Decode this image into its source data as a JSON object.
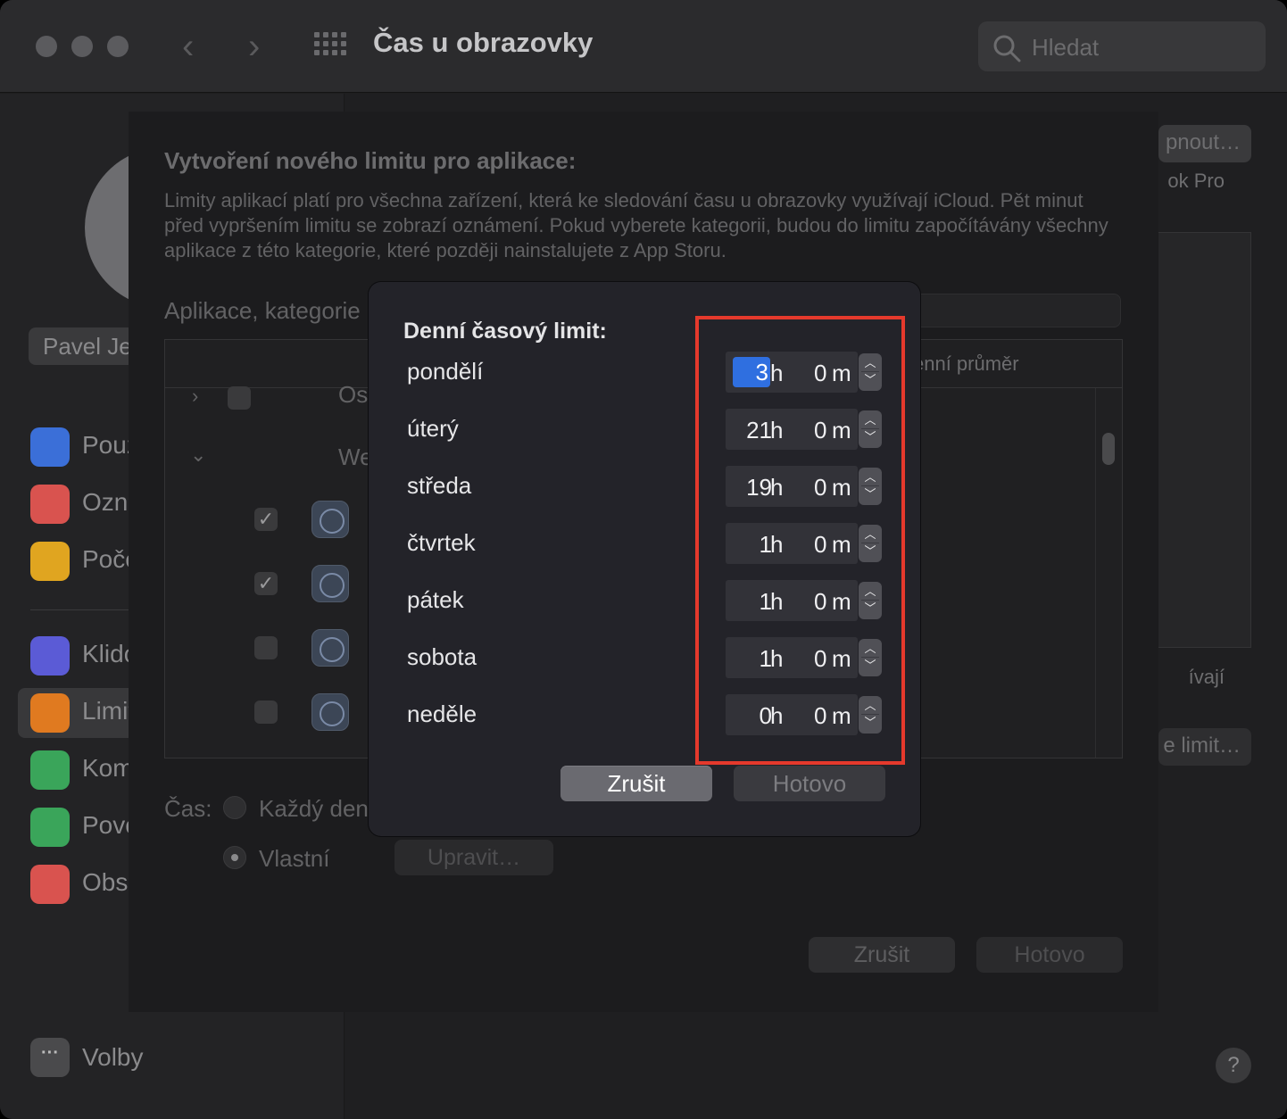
{
  "window": {
    "title": "Čas u obrazovky",
    "search_placeholder": "Hledat"
  },
  "sidebar": {
    "user_name": "Pavel Je",
    "items": [
      {
        "label": "Použ",
        "icon": "chart-bars-icon",
        "color": "#3b6fd8"
      },
      {
        "label": "Ozna",
        "icon": "bell-badge-icon",
        "color": "#d9534f"
      },
      {
        "label": "Poče",
        "icon": "pickups-icon",
        "color": "#e0a520"
      },
      {
        "label": "Klido",
        "icon": "downtime-moon-icon",
        "color": "#5b5bd6"
      },
      {
        "label": "Limit",
        "icon": "hourglass-icon",
        "color": "#e07a20"
      },
      {
        "label": "Kom",
        "icon": "person-circle-icon",
        "color": "#3aa55a"
      },
      {
        "label": "Povo",
        "icon": "check-shield-icon",
        "color": "#3aa55a"
      },
      {
        "label": "Obsa",
        "icon": "no-entry-icon",
        "color": "#d9534f"
      }
    ],
    "options_label": "Volby"
  },
  "right_panel": {
    "button1_fragment": "pnout…",
    "device_fragment": "ok Pro",
    "text_fragment": "ívají",
    "button2_fragment": "e limit…"
  },
  "sheet": {
    "title": "Vytvoření nového limitu pro aplikace:",
    "description": "Limity aplikací platí pro všechna zařízení, která ke sledování času u obrazovky využívají iCloud. Pět minut před vypršením limitu se zobrazí oznámení. Pokud vyberete kategorii, budou do limitu započítávány všechny aplikace z této kategorie, které později nainstalujete z App Storu.",
    "search_label": "Aplikace, kategorie",
    "column_avg": "enní průměr",
    "rows": [
      {
        "label": "Os",
        "checked": false
      },
      {
        "label": "We",
        "checked": false
      }
    ],
    "app_rows": [
      {
        "checked": true
      },
      {
        "checked": true
      },
      {
        "checked": false
      },
      {
        "checked": false
      }
    ],
    "time_label": "Čas:",
    "option_every_day": "Každý den",
    "option_custom": "Vlastní",
    "edit_button": "Upravit…",
    "cancel_button": "Zrušit",
    "done_button": "Hotovo"
  },
  "dialog": {
    "title": "Denní časový limit:",
    "hour_unit": "h",
    "minute_unit": "m",
    "days": [
      {
        "day": "pondělí",
        "hours": "3",
        "minutes": "0"
      },
      {
        "day": "úterý",
        "hours": "21",
        "minutes": "0"
      },
      {
        "day": "středa",
        "hours": "19",
        "minutes": "0"
      },
      {
        "day": "čtvrtek",
        "hours": "1",
        "minutes": "0"
      },
      {
        "day": "pátek",
        "hours": "1",
        "minutes": "0"
      },
      {
        "day": "sobota",
        "hours": "1",
        "minutes": "0"
      },
      {
        "day": "neděle",
        "hours": "0",
        "minutes": "0"
      }
    ],
    "cancel_button": "Zrušit",
    "done_button": "Hotovo"
  },
  "colors": {
    "selection": "#2f6fe0",
    "annotation": "#e5392c"
  }
}
